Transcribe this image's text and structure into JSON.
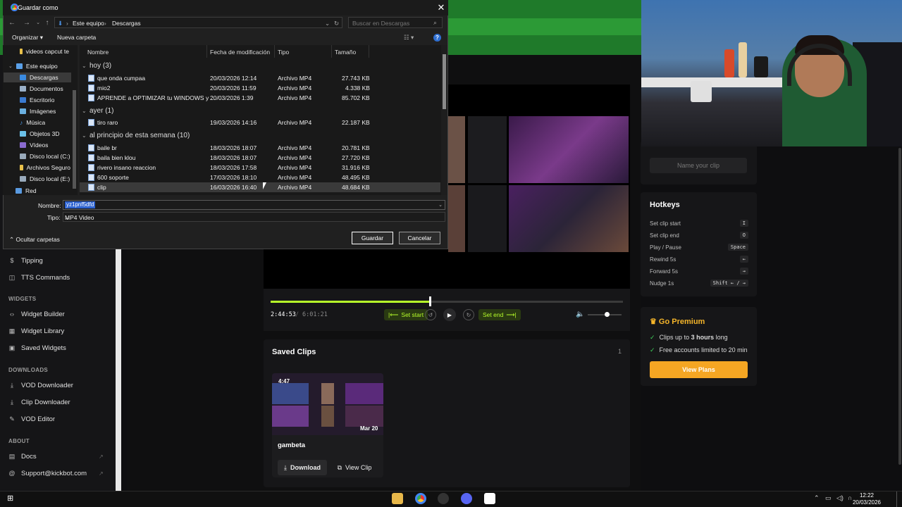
{
  "dialog": {
    "title": "Guardar como",
    "address": [
      "Este equipo",
      "Descargas"
    ],
    "search_placeholder": "Buscar en Descargas",
    "organize": "Organizar",
    "new_folder": "Nueva carpeta",
    "nav": [
      "videos capcut te",
      "Este equipo",
      "Descargas",
      "Documentos",
      "Escritorio",
      "Imágenes",
      "Música",
      "Objetos 3D",
      "Vídeos",
      "Disco local (C:)",
      "Archivos Seguro",
      "Disco local (E:)",
      "Red"
    ],
    "columns": [
      "Nombre",
      "Fecha de modificación",
      "Tipo",
      "Tamaño"
    ],
    "groups": [
      "hoy (3)",
      "ayer (1)",
      "al principio de esta semana (10)"
    ],
    "files": [
      {
        "name": "que onda cumpaa",
        "date": "20/03/2026 12:14",
        "type": "Archivo MP4",
        "size": "27.743 KB"
      },
      {
        "name": "mio2",
        "date": "20/03/2026 11:59",
        "type": "Archivo MP4",
        "size": "4.338 KB"
      },
      {
        "name": "APRENDE a OPTIMIZAR tu WINDOWS y ...",
        "date": "20/03/2026 1:39",
        "type": "Archivo MP4",
        "size": "85.702 KB"
      },
      {
        "name": "tiro raro",
        "date": "19/03/2026 14:16",
        "type": "Archivo MP4",
        "size": "22.187 KB"
      },
      {
        "name": "baile br",
        "date": "18/03/2026 18:07",
        "type": "Archivo MP4",
        "size": "20.781 KB"
      },
      {
        "name": "baila bien klou",
        "date": "18/03/2026 18:07",
        "type": "Archivo MP4",
        "size": "27.720 KB"
      },
      {
        "name": "rivero insano reaccion",
        "date": "18/03/2026 17:58",
        "type": "Archivo MP4",
        "size": "31.916 KB"
      },
      {
        "name": "600 soporte",
        "date": "17/03/2026 18:10",
        "type": "Archivo MP4",
        "size": "48.495 KB"
      },
      {
        "name": "clip",
        "date": "16/03/2026 16:40",
        "type": "Archivo MP4",
        "size": "48.684 KB"
      }
    ],
    "name_label": "Nombre:",
    "name_value": "yz1pnf5dfd",
    "type_label": "Tipo:",
    "type_value": "MP4 Video",
    "save": "Guardar",
    "cancel": "Cancelar",
    "hide_folders": "Ocultar carpetas"
  },
  "sidebar": {
    "items_top": [
      {
        "label": "Tipping",
        "icon": "dollar-icon"
      },
      {
        "label": "TTS Commands",
        "icon": "speech-icon"
      }
    ],
    "widgets_title": "WIDGETS",
    "widgets": [
      {
        "label": "Widget Builder",
        "icon": "code-icon"
      },
      {
        "label": "Widget Library",
        "icon": "grid-icon"
      },
      {
        "label": "Saved Widgets",
        "icon": "bookmark-icon"
      }
    ],
    "downloads_title": "DOWNLOADS",
    "downloads": [
      {
        "label": "VOD Downloader",
        "icon": "download-icon"
      },
      {
        "label": "Clip Downloader",
        "icon": "download-icon"
      },
      {
        "label": "VOD Editor",
        "icon": "pencil-icon"
      }
    ],
    "about_title": "ABOUT",
    "about": [
      {
        "label": "Docs",
        "icon": "doc-icon"
      },
      {
        "label": "Support@kickbot.com",
        "icon": "at-icon"
      }
    ]
  },
  "player": {
    "current_time": "2:44:53",
    "separator": "/",
    "total_time": "6:01:21",
    "progress": 0.453,
    "set_start": "Set start",
    "set_end": "Set end"
  },
  "saved_clips": {
    "title": "Saved Clips",
    "count": "1",
    "clip": {
      "duration": "4:47",
      "date": "Mar 20",
      "name": "gambeta",
      "download": "Download",
      "view": "View Clip"
    }
  },
  "name_panel": {
    "button": "Name your clip"
  },
  "hotkeys": {
    "title": "Hotkeys",
    "rows": [
      {
        "label": "Set clip start",
        "key": "I"
      },
      {
        "label": "Set clip end",
        "key": "O"
      },
      {
        "label": "Play / Pause",
        "key": "Space"
      },
      {
        "label": "Rewind 5s",
        "key": "←"
      },
      {
        "label": "Forward 5s",
        "key": "→"
      },
      {
        "label": "Nudge 1s",
        "key": "Shift  ←  /  →"
      }
    ]
  },
  "premium": {
    "title": "Go Premium",
    "line1_pre": "Clips up to ",
    "line1_bold": "3 hours",
    "line1_post": " long",
    "line2": "Free accounts limited to 20 min",
    "button": "View Plans"
  },
  "taskbar": {
    "time": "12:22",
    "date": "20/03/2026"
  },
  "colors": {
    "accent": "#b7ff2a",
    "premium": "#f5a623",
    "brand_green": "#1f7a2a"
  }
}
